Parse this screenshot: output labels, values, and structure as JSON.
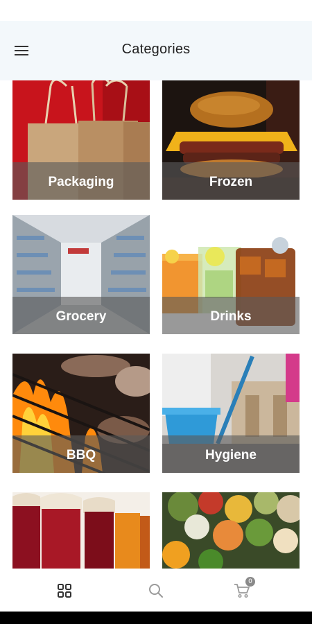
{
  "header": {
    "title": "Categories",
    "menu_icon": "hamburger-menu-icon"
  },
  "categories": [
    {
      "label": "Packaging",
      "image": "kraft paper shopping bags on red"
    },
    {
      "label": "Frozen",
      "image": "burger"
    },
    {
      "label": "Grocery",
      "image": "supermarket aisle"
    },
    {
      "label": "Drinks",
      "image": "iced drinks in glasses"
    },
    {
      "label": "BBQ",
      "image": "grill with flames"
    },
    {
      "label": "Hygiene",
      "image": "mop and blue bucket"
    },
    {
      "label": "",
      "image": "jars of jam"
    },
    {
      "label": "",
      "image": "market vegetables"
    }
  ],
  "bottom_nav": {
    "items": [
      {
        "icon": "grid-icon",
        "active": true
      },
      {
        "icon": "search-icon",
        "active": false
      },
      {
        "icon": "cart-icon",
        "active": false,
        "badge": "0"
      }
    ]
  },
  "colors": {
    "header_bg": "#f3f8fb",
    "label_overlay": "#5a5a5a",
    "nav_active": "#333333",
    "nav_inactive": "#9a9a9a"
  }
}
